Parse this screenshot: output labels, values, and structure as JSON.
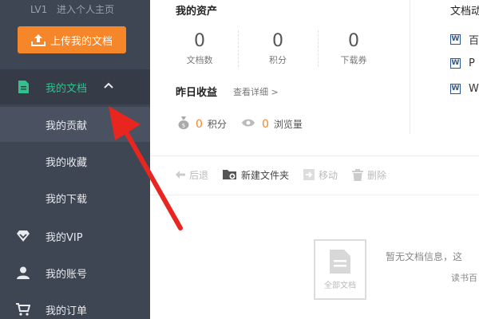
{
  "sidebar": {
    "level": "LV1",
    "home_link": "进入个人主页",
    "upload_label": "上传我的文档",
    "active_item": "我的文档",
    "sub_items": [
      "我的贡献",
      "我的收藏",
      "我的下载"
    ],
    "items": [
      {
        "label": "我的VIP",
        "icon": "diamond-icon"
      },
      {
        "label": "我的账号",
        "icon": "user-icon"
      },
      {
        "label": "我的订单",
        "icon": "cart-icon"
      }
    ]
  },
  "assets": {
    "title": "我的资产",
    "stats": [
      {
        "value": "0",
        "label": "文档数"
      },
      {
        "value": "0",
        "label": "积分"
      },
      {
        "value": "0",
        "label": "下载券"
      }
    ]
  },
  "earnings": {
    "title": "昨日收益",
    "link": "查看详细 >",
    "points_value": "0",
    "points_label": "积分",
    "views_value": "0",
    "views_label": "浏览量"
  },
  "docs_panel": {
    "title": "文档动",
    "items": [
      "百",
      "P",
      "W"
    ]
  },
  "toolbar": {
    "back": "后退",
    "new_folder": "新建文件夹",
    "move": "移动",
    "delete": "删除"
  },
  "empty": {
    "box_caption": "全部文档",
    "message": "暂无文档信息，这",
    "sub": "读书百"
  },
  "colors": {
    "sidebar_bg": "#3e4553",
    "accent_orange": "#f5862a",
    "active_green": "#2fc28c",
    "annotation_red": "#e8251f"
  }
}
